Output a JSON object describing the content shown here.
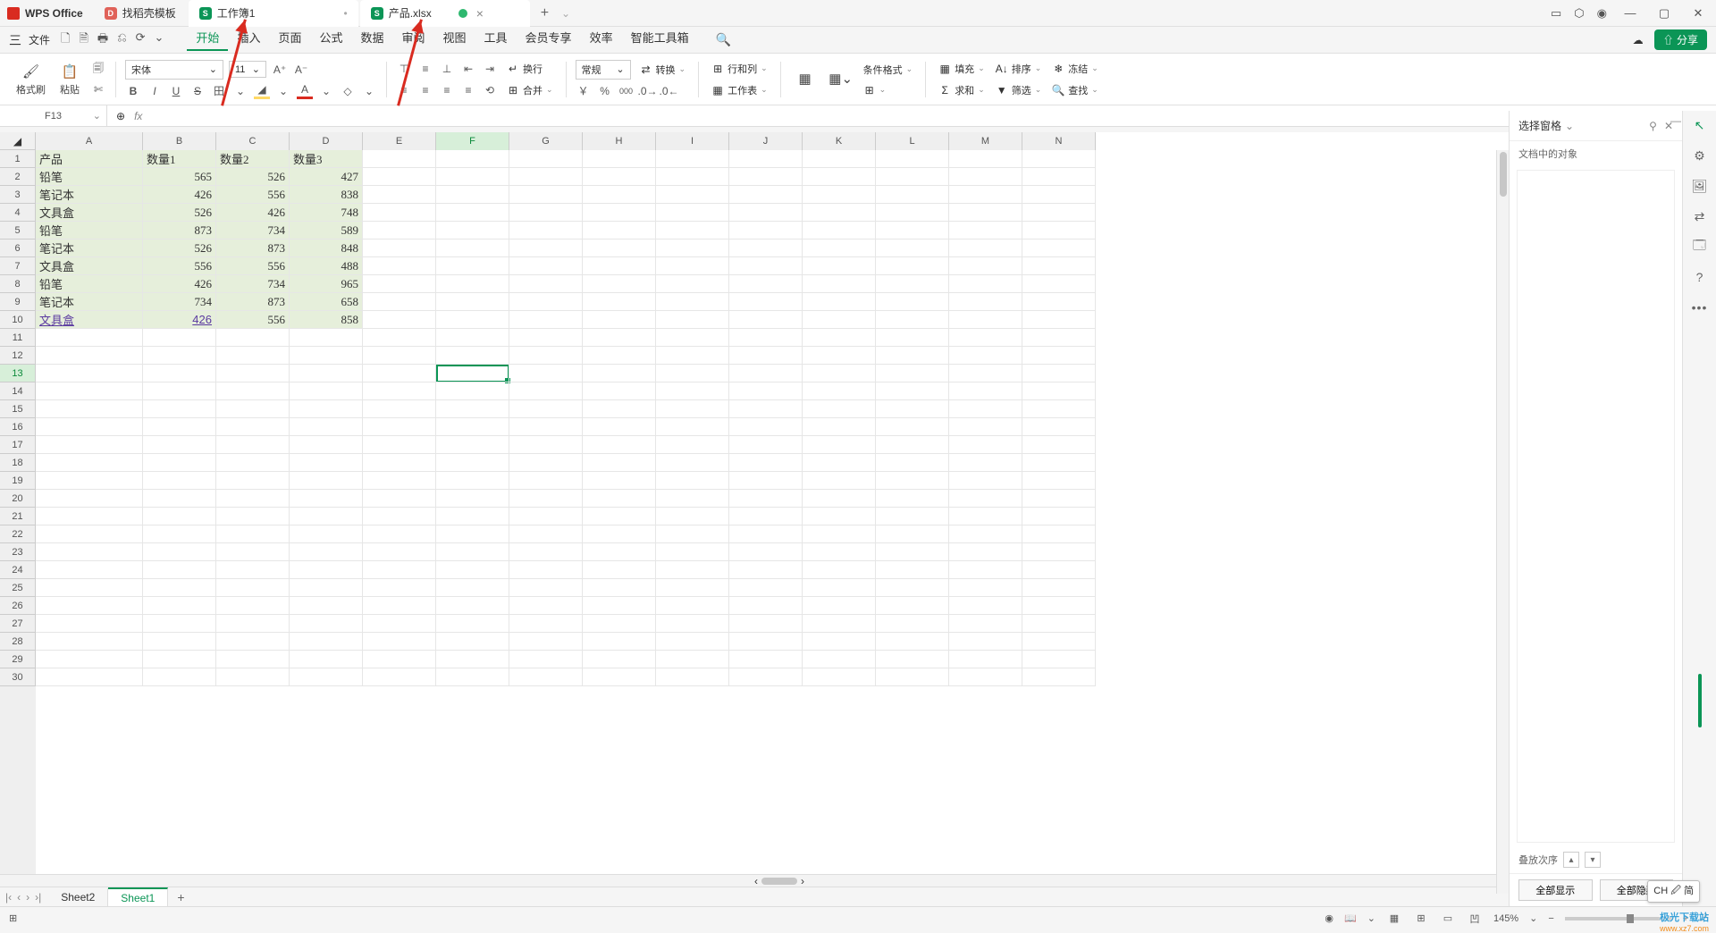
{
  "app": {
    "name": "WPS Office"
  },
  "tabs": {
    "template": "找稻壳模板",
    "workbook1": "工作簿1",
    "product": "产品.xlsx",
    "new": "+"
  },
  "window_controls": {
    "minimize": "—",
    "maximize": "▢",
    "close": "✕"
  },
  "title_icons": {
    "layout": "▭",
    "cube": "⬡",
    "avatar": "◉"
  },
  "file_menu": {
    "burger": "三",
    "label": "文件"
  },
  "quick_access": [
    "🗋",
    "🗎",
    "🖶",
    "⎌",
    "⟳",
    "⌄"
  ],
  "menu": {
    "items": [
      "开始",
      "插入",
      "页面",
      "公式",
      "数据",
      "审阅",
      "视图",
      "工具",
      "会员专享",
      "效率",
      "智能工具箱"
    ],
    "active": 0,
    "search": "🔍",
    "cloud": "☁",
    "share": "⇧ 分享"
  },
  "ribbon": {
    "format_brush": "格式刷",
    "paste": "粘贴",
    "cut": "✄",
    "copy": "🗐",
    "font": "宋体",
    "font_size": "11",
    "inc_font": "A⁺",
    "dec_font": "A⁻",
    "bold": "B",
    "italic": "I",
    "underline": "U",
    "strike": "S",
    "border": "田",
    "fill": "◢",
    "text_color": "A",
    "align_l": "≡",
    "align_c": "≡",
    "align_r": "≡",
    "align_j": "≡",
    "valign_t": "⌃",
    "valign_m": "≡",
    "valign_b": "⌄",
    "indent_dec": "⇤",
    "indent_inc": "⇥",
    "wrap": "换行",
    "merge": "合并",
    "number_fmt": "常规",
    "convert": "转换",
    "currency": "￥",
    "percent": "%",
    "thousand": "000",
    "dec_inc": ".0↑",
    "dec_dec": ".0↓",
    "rowcol": "行和列",
    "table": "工作表",
    "as_table": "▦",
    "styles": "▦",
    "cond_fmt": "条件格式",
    "cell_style": "⊞",
    "fill_group": "填充",
    "sort": "排序",
    "freeze": "冻结",
    "sum": "求和",
    "filter": "筛选",
    "find": "查找"
  },
  "name_box": {
    "value": "F13",
    "fx": "fx",
    "zoom": "⊕"
  },
  "columns": [
    "A",
    "B",
    "C",
    "D",
    "E",
    "F",
    "G",
    "H",
    "I",
    "J",
    "K",
    "L",
    "M",
    "N"
  ],
  "rows": 30,
  "selected_cell": {
    "col": 5,
    "row": 13
  },
  "data_rows": [
    [
      "产品",
      "数量1",
      "数量2",
      "数量3"
    ],
    [
      "铅笔",
      "565",
      "526",
      "427"
    ],
    [
      "笔记本",
      "426",
      "556",
      "838"
    ],
    [
      "文具盒",
      "526",
      "426",
      "748"
    ],
    [
      "铅笔",
      "873",
      "734",
      "589"
    ],
    [
      "笔记本",
      "526",
      "873",
      "848"
    ],
    [
      "文具盒",
      "556",
      "556",
      "488"
    ],
    [
      "铅笔",
      "426",
      "734",
      "965"
    ],
    [
      "笔记本",
      "734",
      "873",
      "658"
    ],
    [
      "文具盒",
      "426",
      "556",
      "858"
    ]
  ],
  "link_cell": {
    "row": 10,
    "col": 0
  },
  "link_cell2": {
    "row": 10,
    "col": 1
  },
  "sheets": {
    "nav": [
      "|‹",
      "‹",
      "›",
      "›|"
    ],
    "items": [
      "Sheet2",
      "Sheet1"
    ],
    "active": 1,
    "add": "+"
  },
  "side_panel": {
    "title": "选择窗格",
    "subtitle": "文档中的对象",
    "stack_label": "叠放次序",
    "show_all": "全部显示",
    "hide_all": "全部隐藏",
    "pin": "⚲",
    "close": "✕"
  },
  "right_rail": [
    "↖",
    "⚙",
    "🖼",
    "⇄",
    "🗔",
    "?",
    "•••"
  ],
  "status": {
    "left_icon": "⊞",
    "right": {
      "eye": "◉",
      "book": "📖",
      "caret": "⌄"
    },
    "views": [
      "▦",
      "⊞",
      "▭",
      "凹"
    ],
    "zoom": "145%",
    "zoom_minus": "−",
    "zoom_plus": "+"
  },
  "ime": "CH 🖉 简",
  "watermark": "极光下载站",
  "watermark_url": "www.xz7.com"
}
